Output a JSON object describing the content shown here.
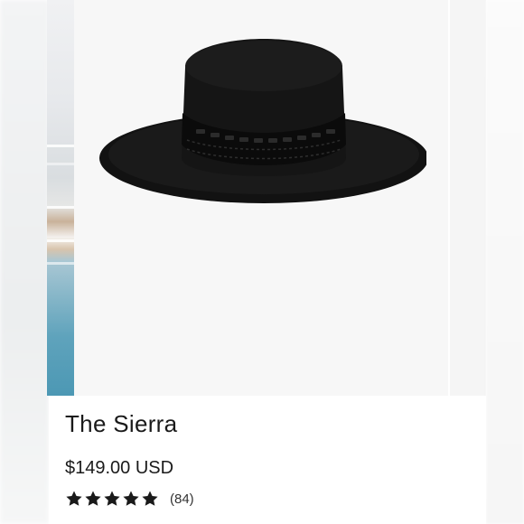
{
  "product": {
    "title": "The Sierra",
    "price": "$149.00 USD",
    "rating": {
      "stars": 5,
      "max": 5,
      "count": "(84)"
    }
  },
  "icons": {
    "star": "star-icon"
  },
  "colors": {
    "text": "#1a1a1a",
    "hat": "#111111",
    "background": "#f7f7f7"
  }
}
